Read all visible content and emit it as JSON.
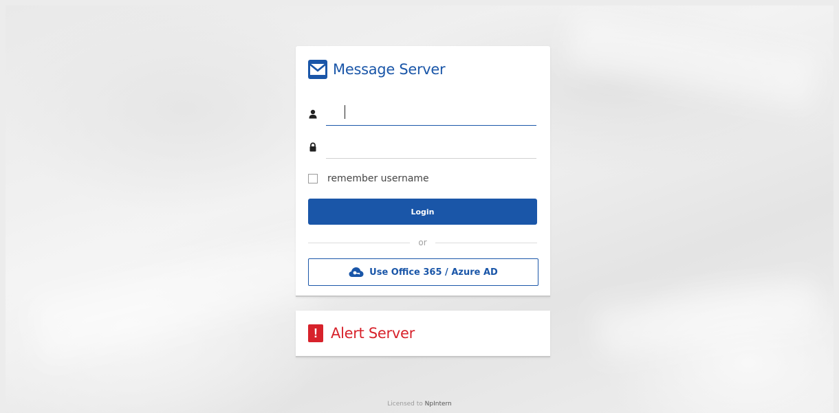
{
  "app": {
    "title": "Message Server"
  },
  "login": {
    "username": {
      "value": "",
      "placeholder": ""
    },
    "password": {
      "value": "",
      "placeholder": ""
    },
    "remember_label": "remember username",
    "remember_checked": false,
    "login_label": "Login",
    "divider_label": "or",
    "sso_label": "Use Office 365 / Azure AD"
  },
  "alert_server": {
    "title": "Alert Server",
    "icon_glyph": "!"
  },
  "footer": {
    "prefix": "Licensed to ",
    "org": "NpIntern"
  },
  "colors": {
    "brand_blue": "#1a56a8",
    "alert_red": "#d7222b"
  },
  "icons": {
    "brand": "envelope-icon",
    "username": "user-icon",
    "password": "lock-icon",
    "sso": "cloud-key-icon",
    "alert": "exclamation-icon"
  }
}
